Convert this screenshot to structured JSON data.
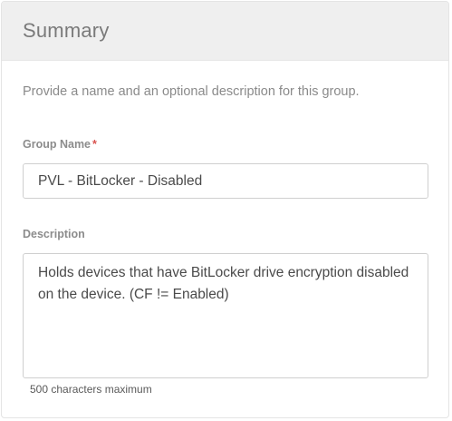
{
  "header": {
    "title": "Summary"
  },
  "intro_text": "Provide a name and an optional description for this group.",
  "group_name": {
    "label": "Group Name",
    "required_marker": "*",
    "value": "PVL - BitLocker - Disabled"
  },
  "description": {
    "label": "Description",
    "value": "Holds devices that have BitLocker drive encryption disabled on the device. (CF != Enabled)",
    "hint": "500 characters maximum"
  },
  "colors": {
    "header_bg": "#efefef",
    "required": "#d9534f",
    "border": "#cfcfcf"
  }
}
